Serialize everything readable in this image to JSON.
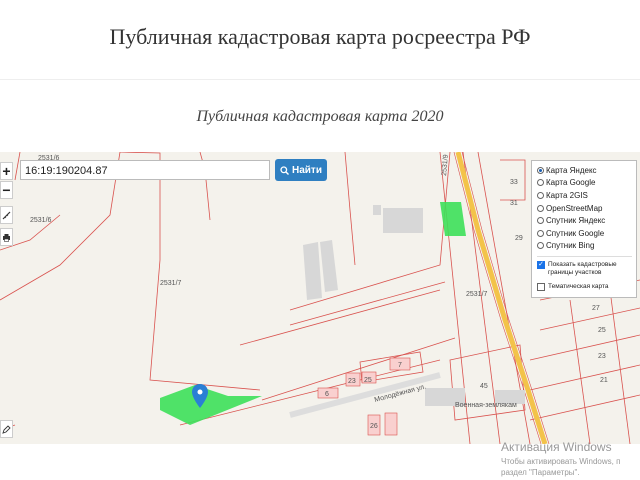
{
  "header": {
    "site_title": "Публичная кадастровая карта росреестра РФ"
  },
  "page": {
    "subtitle": "Публичная кадастровая карта 2020"
  },
  "search": {
    "value": "16:19:190204.87",
    "button_label": "Найти"
  },
  "zoom": {
    "plus": "+",
    "minus": "−"
  },
  "layers": {
    "options": [
      "Карта Яндекс",
      "Карта Google",
      "Карта 2GIS",
      "OpenStreetMap",
      "Спутник Яндекс",
      "Спутник Google",
      "Спутник Bing"
    ],
    "selected": "Карта Яндекс",
    "cadastral_label": "Показать кадастровые границы участков",
    "cadastral_checked": true,
    "thematic_label": "Тематическая карта",
    "thematic_checked": false
  },
  "map_labels": {
    "parcel_a": "2531/6",
    "parcel_b": "2531/6",
    "parcel_c": "2531/7",
    "parcel_d": "2531/7",
    "parcel_e": "2531/9",
    "street": "Молодёжная ул.",
    "street2": "Военная-землякам",
    "n33": "33",
    "n31": "31",
    "n29": "29",
    "n27": "27",
    "n25": "25",
    "n23": "23",
    "n21": "21",
    "n45": "45",
    "b6": "6",
    "b23": "23",
    "b25": "25",
    "b7": "7",
    "b26": "26"
  },
  "watermark": {
    "line1": "Активация Windows",
    "line2": "Чтобы активировать Windows, п",
    "line3": "раздел \"Параметры\"."
  },
  "colors": {
    "accent": "#2f7fc1",
    "parcel_fill": "#3de05a",
    "boundary": "#d9534f",
    "road": "#f3c34a",
    "marker": "#2a7fd4"
  }
}
